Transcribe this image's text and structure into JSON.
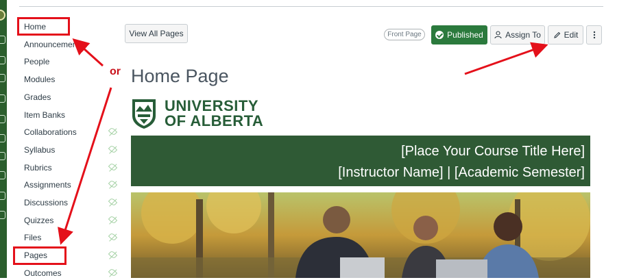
{
  "course_nav": {
    "items": [
      {
        "label": "Home",
        "hidden": false
      },
      {
        "label": "Announcements",
        "hidden": false
      },
      {
        "label": "People",
        "hidden": false
      },
      {
        "label": "Modules",
        "hidden": false
      },
      {
        "label": "Grades",
        "hidden": false
      },
      {
        "label": "Item Banks",
        "hidden": false
      },
      {
        "label": "Collaborations",
        "hidden": true
      },
      {
        "label": "Syllabus",
        "hidden": true
      },
      {
        "label": "Rubrics",
        "hidden": true
      },
      {
        "label": "Assignments",
        "hidden": true
      },
      {
        "label": "Discussions",
        "hidden": true
      },
      {
        "label": "Quizzes",
        "hidden": true
      },
      {
        "label": "Files",
        "hidden": true
      },
      {
        "label": "Pages",
        "hidden": true
      },
      {
        "label": "Outcomes",
        "hidden": true
      }
    ]
  },
  "annotation": {
    "or_label": "or",
    "color": "#e4101a"
  },
  "toolbar": {
    "view_all_pages": "View All Pages",
    "front_page_badge": "Front Page",
    "published": "Published",
    "assign_to": "Assign To",
    "edit": "Edit",
    "more_icon": "kebab-icon"
  },
  "page": {
    "title": "Home Page",
    "logo_line1": "UNIVERSITY",
    "logo_line2": "OF ALBERTA",
    "banner_title": "[Place Your Course Title Here]",
    "banner_subtitle": "[Instructor Name] | [Academic Semester]"
  },
  "colors": {
    "brand_green": "#275d38",
    "banner": "#2f5a35",
    "published": "#2b7a3d"
  }
}
